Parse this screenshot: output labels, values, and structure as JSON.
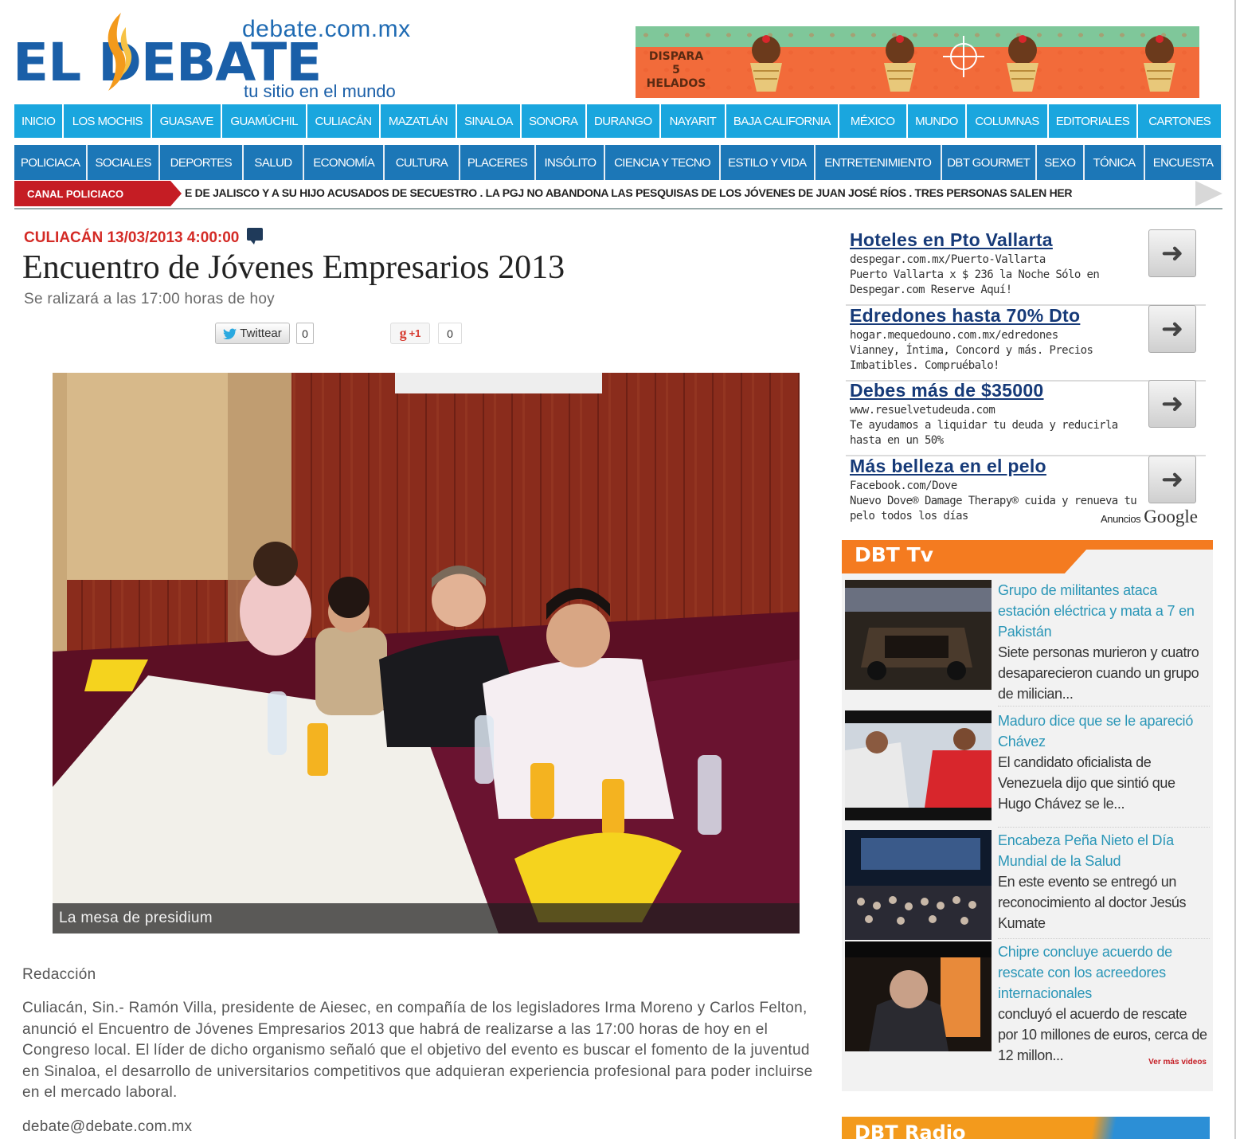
{
  "header": {
    "domain": "debate.com.mx",
    "logo_text": "EL DEBATE",
    "tagline": "tu sitio en el mundo",
    "ad": {
      "text": "DISPARA 5 HELADOS"
    }
  },
  "nav_primary": [
    "INICIO",
    "LOS MOCHIS",
    "GUASAVE",
    "GUAMÚCHIL",
    "CULIACÁN",
    "MAZATLÁN",
    "SINALOA",
    "SONORA",
    "DURANGO",
    "NAYARIT",
    "BAJA CALIFORNIA",
    "MÉXICO",
    "MUNDO",
    "COLUMNAS",
    "EDITORIALES",
    "CARTONES"
  ],
  "nav_secondary": [
    "POLICIACA",
    "SOCIALES",
    "DEPORTES",
    "SALUD",
    "ECONOMÍA",
    "CULTURA",
    "PLACERES",
    "INSÓLITO",
    "CIENCIA Y TECNO",
    "ESTILO Y VIDA",
    "ENTRETENIMIENTO",
    "DBT GOURMET",
    "SEXO",
    "TÓNICA",
    "ENCUESTA"
  ],
  "ticker": {
    "label": "CANAL POLICIACO",
    "text": "E DE JALISCO Y A SU HIJO ACUSADOS DE SECUESTRO . LA PGJ NO ABANDONA LAS PESQUISAS DE LOS JÓVENES DE JUAN JOSÉ RÍOS . TRES PERSONAS SALEN HER"
  },
  "article": {
    "meta": "CULIACÁN 13/03/2013 4:00:00",
    "title": "Encuentro de Jóvenes Empresarios 2013",
    "subtitle": "Se ralizará a las 17:00 horas de hoy",
    "share": {
      "tweet_label": "Twittear",
      "tweet_count": "0",
      "gplus_label": "+1",
      "gplus_count": "0"
    },
    "photo_caption": "La mesa de presidium",
    "byline": "Redacción",
    "body": "Culiacán, Sin.- Ramón Villa, presidente de Aiesec, en compañía de los legisladores Irma Moreno y Carlos Felton, anunció el Encuentro de Jóvenes Empresarios 2013 que habrá de realizarse a las 17:00 horas de hoy en el Congreso local. El líder de dicho organismo señaló que el objetivo del evento es buscar el fomento de la juventud en Sinaloa, el desarrollo de universitarios competitivos que adquieran experiencia profesional para poder incluirse en el mercado laboral.",
    "email": "debate@debate.com.mx"
  },
  "sidebar_ads": [
    {
      "title": "Hoteles en Pto Vallarta",
      "url": "despegar.com.mx/Puerto-Vallarta",
      "desc": "Puerto Vallarta x $ 236 la Noche Sólo en Despegar.com Reserve Aquí!"
    },
    {
      "title": "Edredones hasta 70% Dto",
      "url": "hogar.mequedouno.com.mx/edredones",
      "desc": "Vianney, Íntima, Concord y más. Precios Imbatibles. Compruébalo!"
    },
    {
      "title": "Debes más de $35000",
      "url": "www.resuelvetudeuda.com",
      "desc": "Te ayudamos a liquidar tu deuda y reducirla hasta en un 50%"
    },
    {
      "title": "Más belleza en el pelo",
      "url": "Facebook.com/Dove",
      "desc": "Nuevo Dove® Damage Therapy® cuida y renueva tu pelo todos los días"
    }
  ],
  "ads_by": {
    "anuncios": "Anuncios",
    "google": "Google"
  },
  "dbt_tv": {
    "label": "DBT Tv",
    "items": [
      {
        "title": "Grupo de militantes ataca estación eléctrica y mata a 7 en Pakistán",
        "desc": "Siete personas murieron y cuatro desaparecieron cuando un grupo de milician..."
      },
      {
        "title": "Maduro dice que se le apareció Chávez",
        "desc": "El candidato oficialista de Venezuela dijo que sintió que Hugo Chávez se le..."
      },
      {
        "title": "Encabeza Peña Nieto el Día Mundial de la Salud",
        "desc": "En este evento se entregó un reconocimiento al doctor Jesús Kumate"
      },
      {
        "title": "Chipre concluye acuerdo de rescate con los acreedores internacionales",
        "desc": "concluyó el acuerdo de rescate por 10 millones de euros, cerca de 12 millon..."
      }
    ],
    "more": "Ver más videos"
  },
  "dbt_radio": {
    "label": "DBT Radio"
  },
  "colors": {
    "nav_primary": "#1aa6de",
    "nav_secondary": "#1c77b7",
    "accent_red": "#d42b26",
    "tv_orange": "#f47b20",
    "link_teal": "#2a96b7",
    "ad_title": "#163a78"
  }
}
